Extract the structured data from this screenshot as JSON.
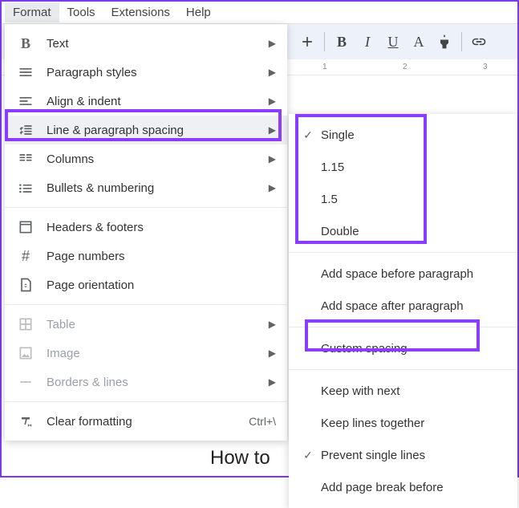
{
  "menubar": {
    "format": "Format",
    "tools": "Tools",
    "extensions": "Extensions",
    "help": "Help"
  },
  "ruler": {
    "n1": "1",
    "n2": "2",
    "n3": "3"
  },
  "format_menu": {
    "text": "Text",
    "paragraph_styles": "Paragraph styles",
    "align_indent": "Align & indent",
    "line_spacing": "Line & paragraph spacing",
    "columns": "Columns",
    "bullets": "Bullets & numbering",
    "headers_footers": "Headers & footers",
    "page_numbers": "Page numbers",
    "page_orientation": "Page orientation",
    "table": "Table",
    "image": "Image",
    "borders_lines": "Borders & lines",
    "clear_formatting": "Clear formatting",
    "clear_shortcut": "Ctrl+\\"
  },
  "spacing_menu": {
    "single": "Single",
    "v115": "1.15",
    "v15": "1.5",
    "double": "Double",
    "add_before": "Add space before paragraph",
    "add_after": "Add space after paragraph",
    "custom": "Custom spacing",
    "keep_next": "Keep with next",
    "keep_lines": "Keep lines together",
    "prevent_single": "Prevent single lines",
    "page_break": "Add page break before"
  },
  "doc": {
    "text": "How to"
  }
}
